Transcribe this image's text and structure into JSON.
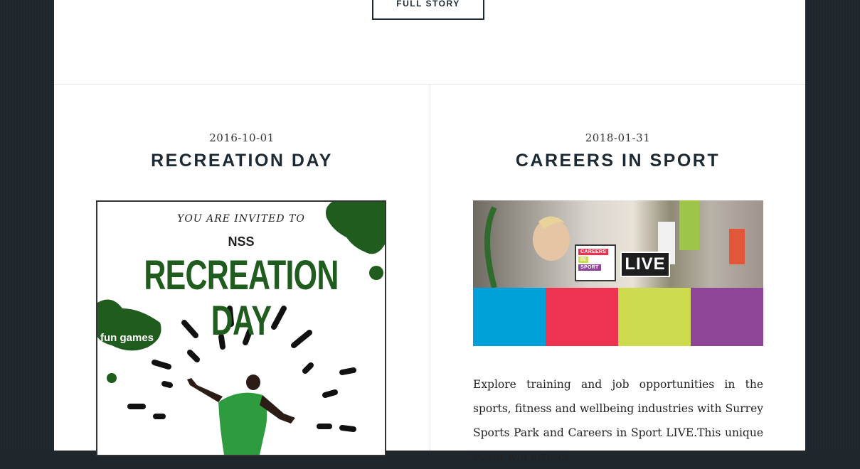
{
  "top": {
    "full_story_label": "FULL STORY"
  },
  "posts": [
    {
      "date": "2016-10-01",
      "title": "RECREATION DAY",
      "poster": {
        "invite": "YOU ARE INVITED TO",
        "org": "NSS",
        "headline": "RECREATION DAY",
        "tag": "fun games"
      }
    },
    {
      "date": "2018-01-31",
      "title": "CAREERS IN SPORT",
      "image": {
        "badge_lines": [
          "CAREERS",
          "IN",
          "SPORT"
        ],
        "live_label": "LIVE",
        "band_colors": [
          "#00a1d9",
          "#ee3350",
          "#cddb4e",
          "#8e4598"
        ]
      },
      "excerpt": "Explore training and job opportunities in the sports, fitness and wellbeing industries with Surrey Sports Park and Careers in Sport LIVE.This unique event will attract"
    }
  ],
  "colors": {
    "page_bg": "#1f262c",
    "heading": "#1e2a33",
    "poster_green": "#1f5c1d"
  }
}
